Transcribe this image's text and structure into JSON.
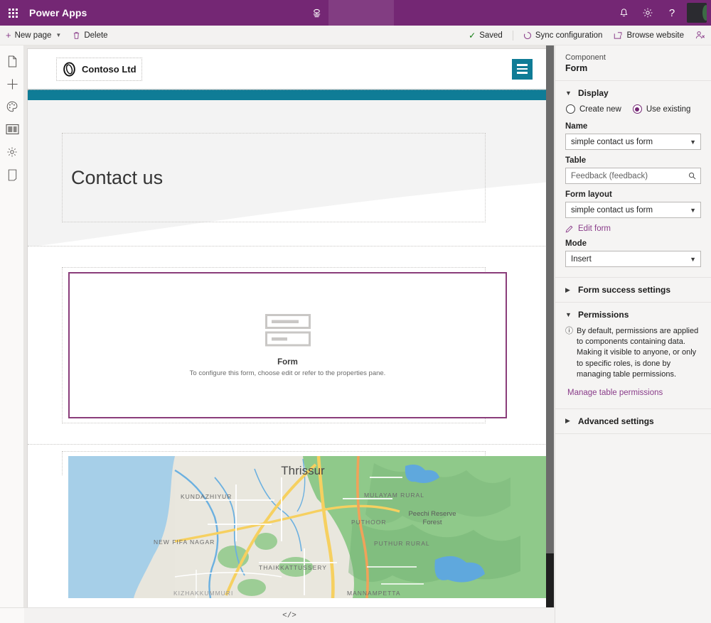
{
  "suite": {
    "waffle_icon": "app-launcher-icon",
    "title": "Power Apps",
    "env_icon": "environment-icon",
    "notifications_icon": "bell-icon",
    "settings_icon": "gear-icon",
    "help_icon": "help-icon",
    "avatar_icon": "user-avatar"
  },
  "command_bar": {
    "new_page_label": "New page",
    "delete_label": "Delete",
    "saved_label": "Saved",
    "sync_label": "Sync configuration",
    "browse_label": "Browse website",
    "invite_icon": "invite-person-icon"
  },
  "rail": {
    "items": [
      {
        "name": "pages",
        "icon": "page-icon"
      },
      {
        "name": "add",
        "icon": "plus-icon"
      },
      {
        "name": "theme",
        "icon": "palette-icon"
      },
      {
        "name": "site-components",
        "icon": "layout-card-icon"
      },
      {
        "name": "settings",
        "icon": "gear-icon"
      },
      {
        "name": "mobile-preview",
        "icon": "mobile-device-icon"
      }
    ]
  },
  "canvas": {
    "brand_name": "Contoso Ltd",
    "brand_logo_icon": "contoso-ring-logo",
    "menu_icon": "hamburger-menu-icon",
    "hero_title": "Contact us",
    "form_placeholder": {
      "icon": "form-fields-icon",
      "title": "Form",
      "subtitle": "To configure this form, choose edit or refer to the properties pane."
    },
    "map": {
      "city_label": "Thrissur",
      "labels": [
        "KUNDAZHIYUR",
        "NEW FIFA NAGAR",
        "THAIKKATTUSSERY",
        "KIZHAKKUMMURI",
        "MANNAMPETTA",
        "MULAYAM RURAL",
        "PUTHOOR",
        "PUTHUR RURAL",
        "Peechi Reserve Forest"
      ]
    },
    "accent_color": "#0f7c96",
    "selection_color": "#8a3d7a"
  },
  "properties": {
    "kicker": "Component",
    "title": "Form",
    "display": {
      "title": "Display",
      "chevron": "chevron-down-icon",
      "radio_create_new": "Create new",
      "radio_use_existing": "Use existing",
      "name_label": "Name",
      "name_value": "simple contact us form",
      "table_label": "Table",
      "table_value": "Feedback (feedback)",
      "form_layout_label": "Form layout",
      "form_layout_value": "simple contact us form",
      "edit_form_link": "Edit form",
      "mode_label": "Mode",
      "mode_value": "Insert"
    },
    "form_success": {
      "title": "Form success settings",
      "chevron": "chevron-right-icon"
    },
    "permissions": {
      "title": "Permissions",
      "chevron": "chevron-down-icon",
      "note": "By default, permissions are applied to components containing data. Making it visible to anyone, or only to specific roles, is done by managing table permissions.",
      "link": "Manage table permissions"
    },
    "advanced": {
      "title": "Advanced settings",
      "chevron": "chevron-right-icon"
    }
  },
  "status_bar": {
    "code_label": "</>"
  },
  "colors": {
    "brand_purple": "#742774",
    "accent_teal": "#0f7c96",
    "selection_purple": "#8a3d7a",
    "link_purple": "#8a3d8a",
    "success_green": "#107c10"
  }
}
